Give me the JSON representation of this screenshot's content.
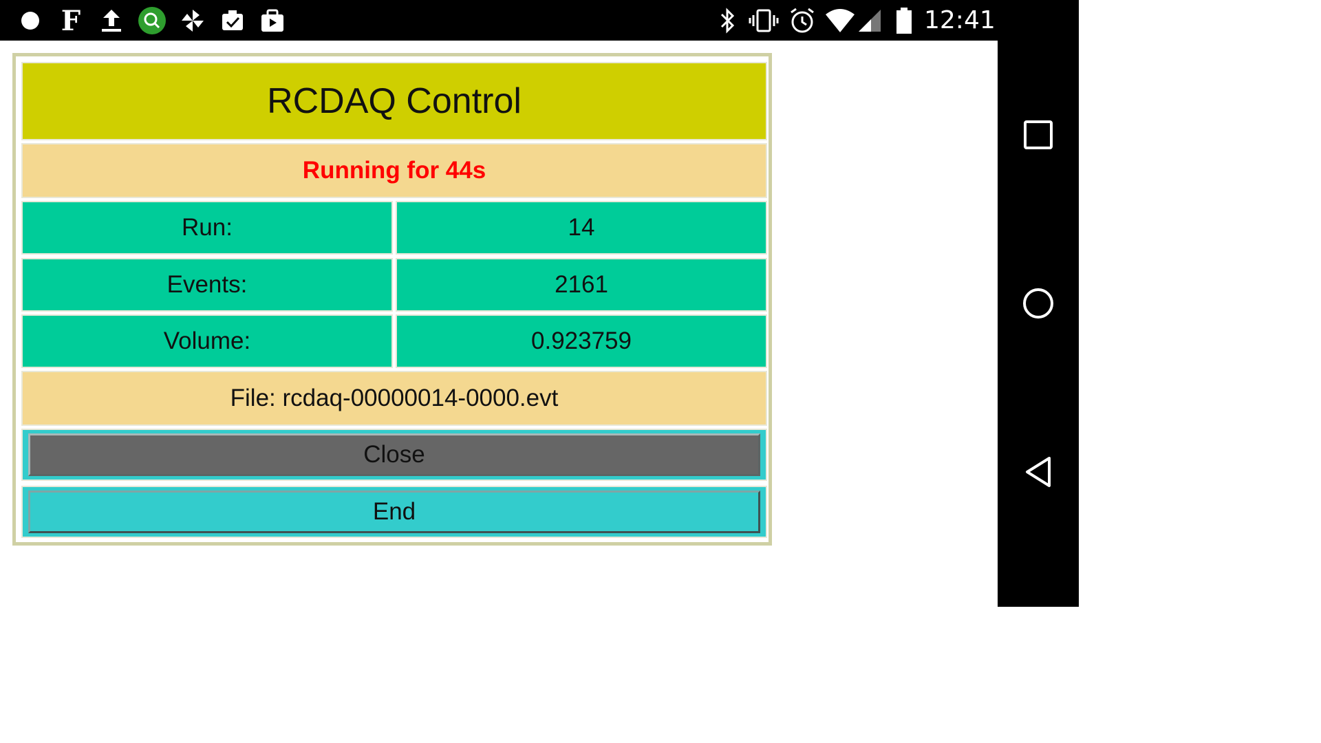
{
  "status_bar": {
    "time": "12:41",
    "left_icons": [
      "dot-icon",
      "flipboard-icon",
      "upload-icon",
      "search-app-icon",
      "pinwheel-icon",
      "clipboard-check-icon",
      "play-store-icon"
    ],
    "right_icons": [
      "bluetooth-icon",
      "vibrate-icon",
      "alarm-icon",
      "wifi-icon",
      "signal-icon",
      "battery-icon"
    ]
  },
  "app": {
    "title": "RCDAQ Control",
    "status": "Running for 44s",
    "rows": [
      {
        "label": "Run:",
        "value": "14"
      },
      {
        "label": "Events:",
        "value": "2161"
      },
      {
        "label": "Volume:",
        "value": "0.923759"
      }
    ],
    "file": "File: rcdaq-00000014-0000.evt",
    "close_label": "Close",
    "end_label": "End"
  },
  "nav_bar": {
    "icons": [
      "recents-icon",
      "home-icon",
      "back-icon"
    ]
  },
  "colors": {
    "title_bg": "#cfcf00",
    "status_bg": "#f4d890",
    "status_text": "#ff0000",
    "row_bg": "#00cc99",
    "close_bg": "#666666",
    "end_bg": "#33cccc"
  }
}
